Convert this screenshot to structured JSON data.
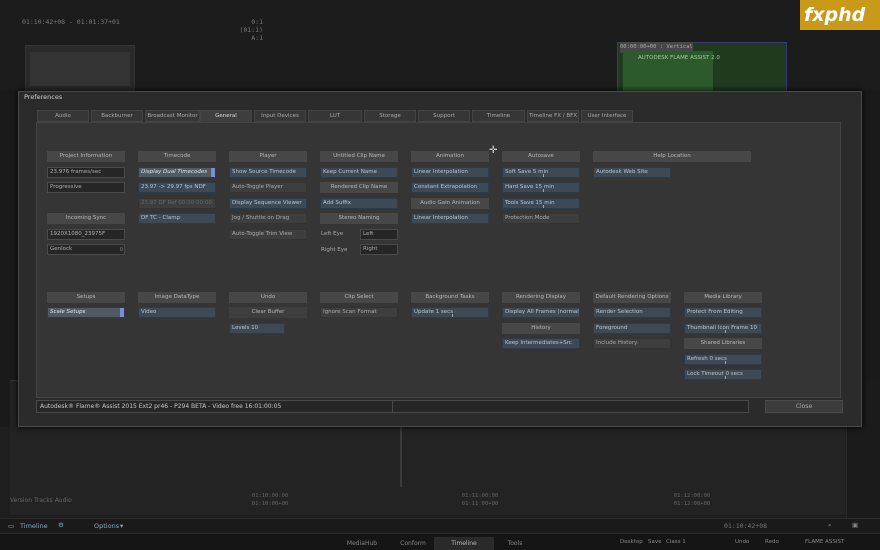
{
  "background": {
    "tc_left": "01:10:42+08 - 01:01:37+01",
    "tc_right_1": "0:1 (01:1)",
    "tc_right_2": "A:1",
    "viewer_right_header": "00:00:00+00 : Vertical",
    "viewer_right_text": "AUTODESK FLAME ASSIST 2.0",
    "logo": "fxphd",
    "tracks_label": "Version  Tracks  Audio",
    "timecodes": [
      {
        "a": "01:10:00:00",
        "b": "01:10:00+00"
      },
      {
        "a": "01:11:00:00",
        "b": "01:11:00+00"
      },
      {
        "a": "01:12:00:00",
        "b": "01:12:00+00"
      }
    ],
    "toolbar": {
      "timeline": "Timeline",
      "options": "Options",
      "tc": "01:10:42+08"
    },
    "status_tabs": [
      "MediaHub",
      "Conform",
      "Timeline",
      "Tools"
    ],
    "status_active": "Timeline",
    "status_right": [
      "Desktop",
      "Save",
      "Class 1",
      "Undo",
      "Redo",
      "FLAME ASSIST"
    ]
  },
  "dialog": {
    "title": "Preferences",
    "tabs": [
      "Audio",
      "Backburner",
      "Broadcast Monitor",
      "General",
      "Input Devices",
      "LUT",
      "Storage",
      "Support",
      "Timeline",
      "Timeline FX / BFX",
      "User Interface"
    ],
    "active_tab": "General",
    "project_information": {
      "header": "Project Information",
      "frame_rate": "23.976 frames/sec",
      "scan_mode": "Progressive"
    },
    "incoming_sync": {
      "header": "Incoming Sync",
      "resolution": "1920X1080_23975F",
      "genlock": "Genlock",
      "genlock_value": "0"
    },
    "timecode": {
      "header": "Timecode",
      "display_dual": "Display Dual Timecodes",
      "conversion": "23.97 -> 29.97 fps NDF",
      "df_ref": "23.97 DF Ref 00:00:00:00",
      "df_tc": "DF TC - Clamp"
    },
    "player": {
      "header": "Player",
      "show_source_tc": "Show Source Timecode",
      "auto_toggle_player": "Auto-Toggle Player",
      "display_seq_viewer": "Display Sequence Viewer",
      "jog_shuttle": "Jog / Shuttle on Drag",
      "auto_toggle_trim": "Auto-Toggle Trim View"
    },
    "untitled_clip_name": {
      "header": "Untitled Clip Name",
      "keep_current": "Keep Current Name"
    },
    "rendered_clip_name": {
      "header": "Rendered Clip Name",
      "add_suffix": "Add Suffix"
    },
    "stereo_naming": {
      "header": "Stereo Naming",
      "left_eye_label": "Left Eye",
      "left_eye_value": "Left",
      "right_eye_label": "Right Eye",
      "right_eye_value": "Right"
    },
    "animation": {
      "header": "Animation",
      "linear_interp": "Linear Interpolation",
      "constant_extrap": "Constant Extrapolation"
    },
    "audio_gain_animation": {
      "header": "Audio Gain Animation",
      "linear_interp": "Linear Interpolation"
    },
    "autosave": {
      "header": "Autosave",
      "soft_save": "Soft Save 5 min",
      "hard_save": "Hard Save 15 min",
      "tools_save": "Tools Save 15 min",
      "protection_mode": "Protection Mode"
    },
    "help_location": {
      "header": "Help Location",
      "web_site": "Autodesk Web Site"
    },
    "setups": {
      "header": "Setups",
      "scale_setups": "Scale Setups"
    },
    "image_datatype": {
      "header": "Image DataType",
      "video": "Video"
    },
    "undo": {
      "header": "Undo",
      "clear_buffer": "Clear Buffer",
      "levels": "Levels 10"
    },
    "clip_select": {
      "header": "Clip Select",
      "ignore_scan": "Ignore Scan Format"
    },
    "background_tasks": {
      "header": "Background Tasks",
      "update": "Update 1 secs"
    },
    "rendering_display": {
      "header": "Rendering Display",
      "display_all": "Display All Frames (normal)"
    },
    "history": {
      "header": "History",
      "keep_intermediates": "Keep Intermediates+Src"
    },
    "default_rendering_options": {
      "header": "Default Rendering Options",
      "render_selection": "Render Selection",
      "foreground": "Foreground",
      "include_history": "Include History"
    },
    "media_library": {
      "header": "Media Library",
      "protect_editing": "Protect From Editing",
      "thumbnail": "Thumbnail Icon Frame 10"
    },
    "shared_libraries": {
      "header": "Shared Libraries",
      "refresh": "Refresh 0 secs",
      "lock_timeout": "Lock Timeout 0 secs"
    },
    "status_text": "Autodesk® Flame® Assist 2015 Ext2 pr46 - P294 BETA - Video free 16:01:00:05",
    "close_label": "Close"
  }
}
